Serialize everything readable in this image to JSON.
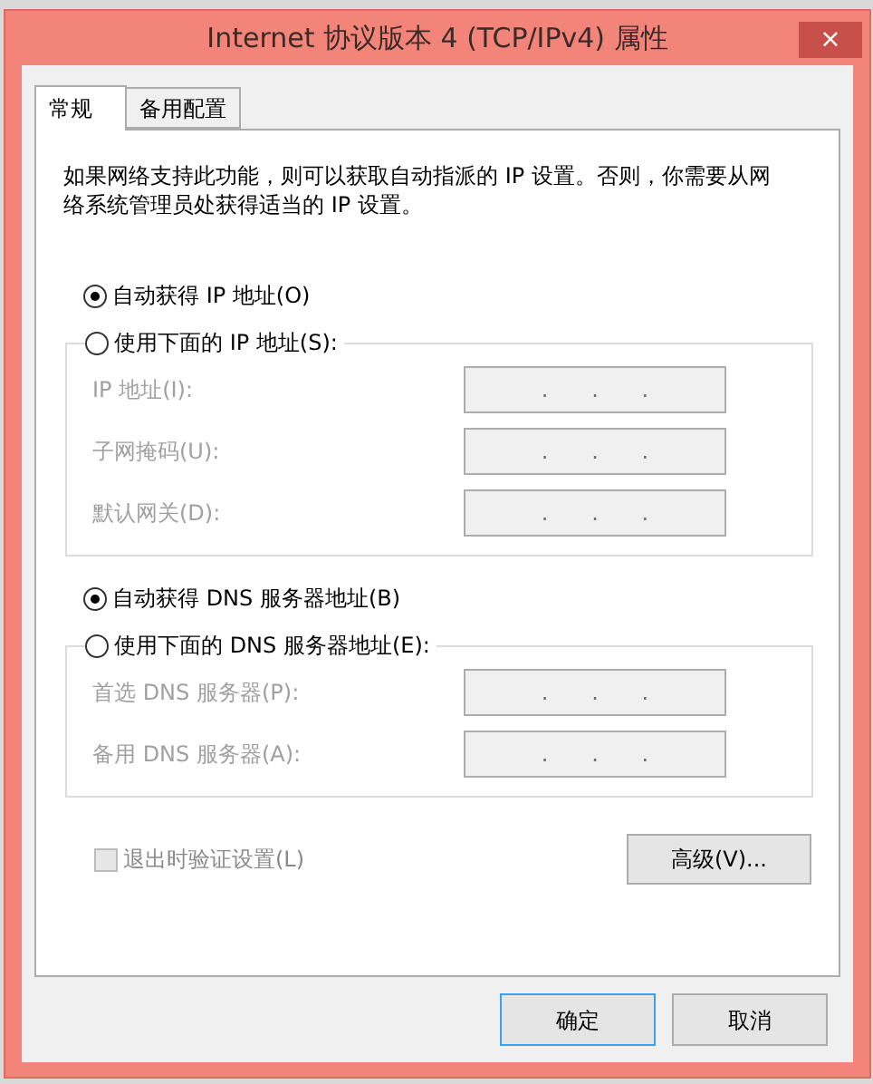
{
  "window": {
    "title": "Internet 协议版本 4 (TCP/IPv4) 属性",
    "close": "×"
  },
  "tabs": [
    {
      "label": "常规",
      "selected": true
    },
    {
      "label": "备用配置",
      "selected": false
    }
  ],
  "description": "如果网络支持此功能，则可以获取自动指派的 IP 设置。否则，你需要从网络系统管理员处获得适当的 IP 设置。",
  "groups": [
    {
      "auto_option": {
        "label": "自动获得 IP 地址(O)",
        "selected": true
      },
      "manual_option": {
        "label": "使用下面的 IP 地址(S):",
        "selected": false
      },
      "fields": [
        {
          "label": "IP 地址(I):",
          "disabled": true,
          "dots": [
            ".",
            ".",
            "."
          ]
        },
        {
          "label": "子网掩码(U):",
          "disabled": true,
          "dots": [
            ".",
            ".",
            "."
          ]
        },
        {
          "label": "默认网关(D):",
          "disabled": true,
          "dots": [
            ".",
            ".",
            "."
          ]
        }
      ]
    },
    {
      "auto_option": {
        "label": "自动获得 DNS 服务器地址(B)",
        "selected": true
      },
      "manual_option": {
        "label": "使用下面的 DNS 服务器地址(E):",
        "selected": false
      },
      "fields": [
        {
          "label": "首选 DNS 服务器(P):",
          "disabled": true,
          "dots": [
            ".",
            ".",
            "."
          ]
        },
        {
          "label": "备用 DNS 服务器(A):",
          "disabled": true,
          "dots": [
            ".",
            ".",
            "."
          ]
        }
      ]
    }
  ],
  "validate_checkbox": {
    "label": "退出时验证设置(L)",
    "checked": false,
    "disabled": true
  },
  "advanced_button": "高级(V)...",
  "buttons": [
    {
      "label": "确定",
      "default": true
    },
    {
      "label": "取消",
      "default": false
    }
  ]
}
